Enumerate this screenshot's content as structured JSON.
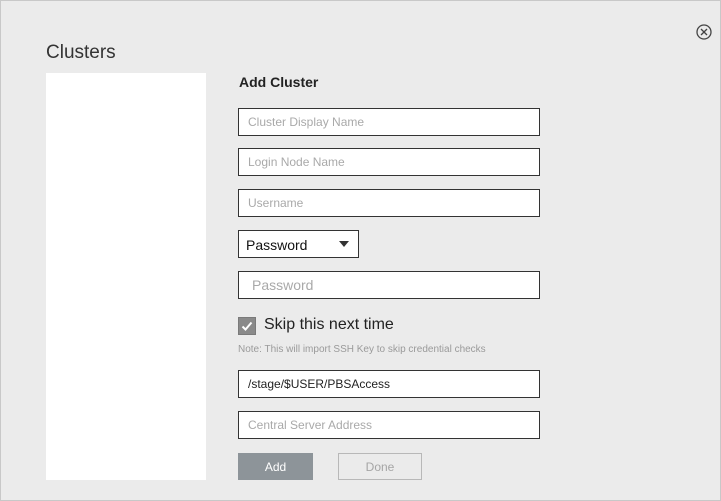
{
  "sidebar": {
    "title": "Clusters"
  },
  "form": {
    "title": "Add Cluster",
    "display_name": {
      "placeholder": "Cluster Display Name",
      "value": ""
    },
    "login_node": {
      "placeholder": "Login Node Name",
      "value": ""
    },
    "username": {
      "placeholder": "Username",
      "value": ""
    },
    "auth_method": {
      "selected": "Password"
    },
    "password": {
      "placeholder": "Password",
      "value": ""
    },
    "skip_checkbox": {
      "label": "Skip this next time",
      "checked": true
    },
    "note": "Note: This will import SSH Key to skip credential checks",
    "stage_path": {
      "placeholder": "",
      "value": "/stage/$USER/PBSAccess"
    },
    "central_server": {
      "placeholder": "Central Server Address",
      "value": ""
    },
    "add_label": "Add",
    "done_label": "Done"
  },
  "icons": {
    "close": "close-circle-icon",
    "dropdown": "chevron-down-icon",
    "checkmark": "checkmark-icon"
  },
  "colors": {
    "dialog_background": "#ebebeb",
    "list_background": "#ffffff",
    "field_border": "#333333",
    "add_button": "#8d9499",
    "checkbox_fill": "#8a8a8a"
  }
}
